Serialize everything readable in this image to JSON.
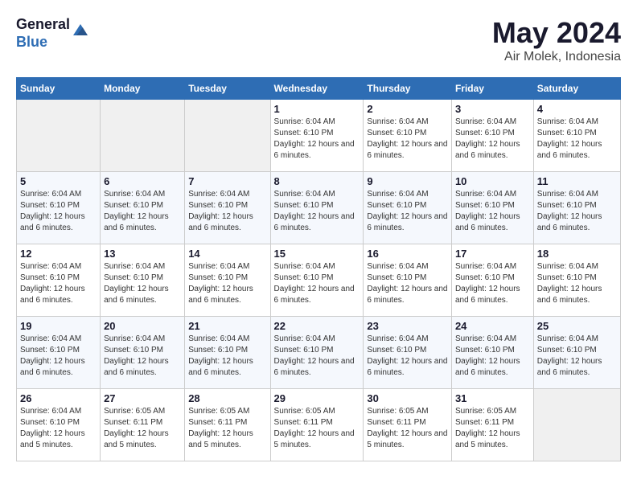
{
  "app": {
    "name_line1": "General",
    "name_line2": "Blue"
  },
  "calendar": {
    "month_year": "May 2024",
    "location": "Air Molek, Indonesia",
    "days_of_week": [
      "Sunday",
      "Monday",
      "Tuesday",
      "Wednesday",
      "Thursday",
      "Friday",
      "Saturday"
    ],
    "weeks": [
      [
        {
          "day": "",
          "info": ""
        },
        {
          "day": "",
          "info": ""
        },
        {
          "day": "",
          "info": ""
        },
        {
          "day": "1",
          "info": "Sunrise: 6:04 AM\nSunset: 6:10 PM\nDaylight: 12 hours and 6 minutes."
        },
        {
          "day": "2",
          "info": "Sunrise: 6:04 AM\nSunset: 6:10 PM\nDaylight: 12 hours and 6 minutes."
        },
        {
          "day": "3",
          "info": "Sunrise: 6:04 AM\nSunset: 6:10 PM\nDaylight: 12 hours and 6 minutes."
        },
        {
          "day": "4",
          "info": "Sunrise: 6:04 AM\nSunset: 6:10 PM\nDaylight: 12 hours and 6 minutes."
        }
      ],
      [
        {
          "day": "5",
          "info": "Sunrise: 6:04 AM\nSunset: 6:10 PM\nDaylight: 12 hours and 6 minutes."
        },
        {
          "day": "6",
          "info": "Sunrise: 6:04 AM\nSunset: 6:10 PM\nDaylight: 12 hours and 6 minutes."
        },
        {
          "day": "7",
          "info": "Sunrise: 6:04 AM\nSunset: 6:10 PM\nDaylight: 12 hours and 6 minutes."
        },
        {
          "day": "8",
          "info": "Sunrise: 6:04 AM\nSunset: 6:10 PM\nDaylight: 12 hours and 6 minutes."
        },
        {
          "day": "9",
          "info": "Sunrise: 6:04 AM\nSunset: 6:10 PM\nDaylight: 12 hours and 6 minutes."
        },
        {
          "day": "10",
          "info": "Sunrise: 6:04 AM\nSunset: 6:10 PM\nDaylight: 12 hours and 6 minutes."
        },
        {
          "day": "11",
          "info": "Sunrise: 6:04 AM\nSunset: 6:10 PM\nDaylight: 12 hours and 6 minutes."
        }
      ],
      [
        {
          "day": "12",
          "info": "Sunrise: 6:04 AM\nSunset: 6:10 PM\nDaylight: 12 hours and 6 minutes."
        },
        {
          "day": "13",
          "info": "Sunrise: 6:04 AM\nSunset: 6:10 PM\nDaylight: 12 hours and 6 minutes."
        },
        {
          "day": "14",
          "info": "Sunrise: 6:04 AM\nSunset: 6:10 PM\nDaylight: 12 hours and 6 minutes."
        },
        {
          "day": "15",
          "info": "Sunrise: 6:04 AM\nSunset: 6:10 PM\nDaylight: 12 hours and 6 minutes."
        },
        {
          "day": "16",
          "info": "Sunrise: 6:04 AM\nSunset: 6:10 PM\nDaylight: 12 hours and 6 minutes."
        },
        {
          "day": "17",
          "info": "Sunrise: 6:04 AM\nSunset: 6:10 PM\nDaylight: 12 hours and 6 minutes."
        },
        {
          "day": "18",
          "info": "Sunrise: 6:04 AM\nSunset: 6:10 PM\nDaylight: 12 hours and 6 minutes."
        }
      ],
      [
        {
          "day": "19",
          "info": "Sunrise: 6:04 AM\nSunset: 6:10 PM\nDaylight: 12 hours and 6 minutes."
        },
        {
          "day": "20",
          "info": "Sunrise: 6:04 AM\nSunset: 6:10 PM\nDaylight: 12 hours and 6 minutes."
        },
        {
          "day": "21",
          "info": "Sunrise: 6:04 AM\nSunset: 6:10 PM\nDaylight: 12 hours and 6 minutes."
        },
        {
          "day": "22",
          "info": "Sunrise: 6:04 AM\nSunset: 6:10 PM\nDaylight: 12 hours and 6 minutes."
        },
        {
          "day": "23",
          "info": "Sunrise: 6:04 AM\nSunset: 6:10 PM\nDaylight: 12 hours and 6 minutes."
        },
        {
          "day": "24",
          "info": "Sunrise: 6:04 AM\nSunset: 6:10 PM\nDaylight: 12 hours and 6 minutes."
        },
        {
          "day": "25",
          "info": "Sunrise: 6:04 AM\nSunset: 6:10 PM\nDaylight: 12 hours and 6 minutes."
        }
      ],
      [
        {
          "day": "26",
          "info": "Sunrise: 6:04 AM\nSunset: 6:10 PM\nDaylight: 12 hours and 5 minutes."
        },
        {
          "day": "27",
          "info": "Sunrise: 6:05 AM\nSunset: 6:11 PM\nDaylight: 12 hours and 5 minutes."
        },
        {
          "day": "28",
          "info": "Sunrise: 6:05 AM\nSunset: 6:11 PM\nDaylight: 12 hours and 5 minutes."
        },
        {
          "day": "29",
          "info": "Sunrise: 6:05 AM\nSunset: 6:11 PM\nDaylight: 12 hours and 5 minutes."
        },
        {
          "day": "30",
          "info": "Sunrise: 6:05 AM\nSunset: 6:11 PM\nDaylight: 12 hours and 5 minutes."
        },
        {
          "day": "31",
          "info": "Sunrise: 6:05 AM\nSunset: 6:11 PM\nDaylight: 12 hours and 5 minutes."
        },
        {
          "day": "",
          "info": ""
        }
      ]
    ]
  }
}
